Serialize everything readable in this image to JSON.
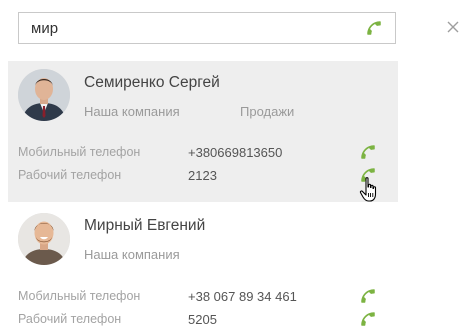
{
  "search": {
    "value": "мир",
    "call_icon": "phone-icon"
  },
  "close_icon": "close-icon",
  "accent_color": "#7cb342",
  "contacts": [
    {
      "name": "Семиренко Сергей",
      "company": "Наша компания",
      "department": "Продажи",
      "selected": true,
      "phones": [
        {
          "label": "Мобильный телефон",
          "value": "+380669813650"
        },
        {
          "label": "Рабочий телефон",
          "value": "2123"
        }
      ]
    },
    {
      "name": "Мирный Евгений",
      "company": "Наша компания",
      "department": "",
      "selected": false,
      "phones": [
        {
          "label": "Мобильный телефон",
          "value": "+38 067 89 34 461"
        },
        {
          "label": "Рабочий телефон",
          "value": "5205"
        }
      ]
    }
  ]
}
